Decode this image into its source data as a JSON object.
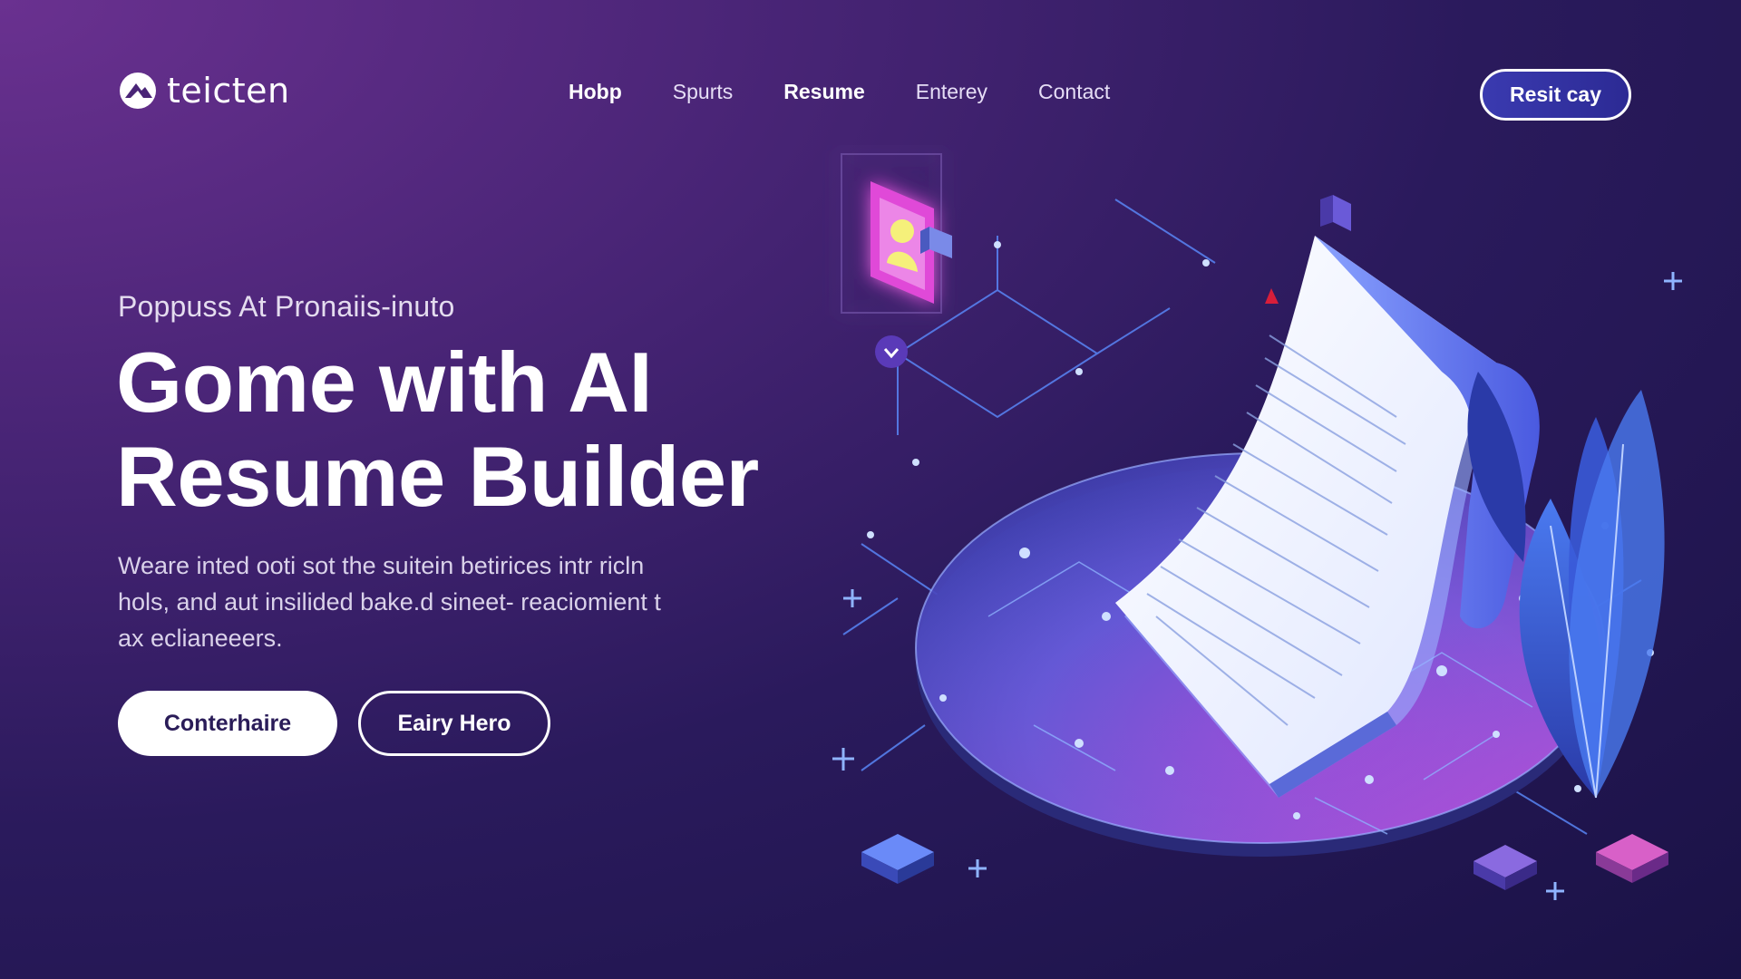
{
  "brand": {
    "name": "teicten",
    "logo_icon": "mountain-logo-icon"
  },
  "nav": {
    "items": [
      {
        "label": "Hobp",
        "bold": true
      },
      {
        "label": "Spurts",
        "bold": false
      },
      {
        "label": "Resume",
        "bold": true
      },
      {
        "label": "Enterey",
        "bold": false
      },
      {
        "label": "Contact",
        "bold": false
      }
    ]
  },
  "header_cta": {
    "label": "Resit cay"
  },
  "hero": {
    "eyebrow": "Poppuss At Pronaiis-inuto",
    "headline_line1": "Gome with AI",
    "headline_line2": "Resume Builder",
    "description": "Weare inted ooti sot the suitein betirices intr ricln hols, and aut insilided bake.d sineet- reaciomient t ax eclianeeers.",
    "primary_button": "Conterhaire",
    "secondary_button": "Eairy Hero"
  },
  "illustration": {
    "icons": [
      "resume-document-icon",
      "profile-card-icon",
      "plant-leaf-icon",
      "shield-badge-icon",
      "chevron-badge-icon",
      "cube-icon"
    ]
  },
  "colors": {
    "accent": "#3a3ab0",
    "bg_dark": "#1a1246",
    "bg_purple": "#6a3190",
    "pink_glow": "#e04ad8",
    "blue_line": "#5b8cff"
  }
}
